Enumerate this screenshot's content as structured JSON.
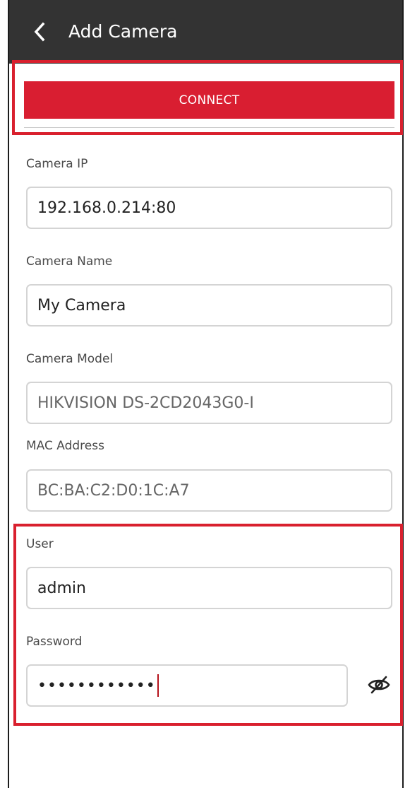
{
  "header": {
    "title": "Add Camera",
    "back_icon": "chevron-left-icon"
  },
  "connect": {
    "label": "CONNECT"
  },
  "fields": {
    "camera_ip": {
      "label": "Camera IP",
      "value": "192.168.0.214:80"
    },
    "camera_name": {
      "label": "Camera Name",
      "value": "My Camera"
    },
    "camera_model": {
      "label": "Camera Model",
      "value": "HIKVISION DS-2CD2043G0-I"
    },
    "mac_address": {
      "label": "MAC Address",
      "value": "BC:BA:C2:D0:1C:A7"
    },
    "user": {
      "label": "User",
      "value": "admin"
    },
    "password": {
      "label": "Password",
      "value": "••••••••••••",
      "toggle_icon": "eye-off-icon"
    }
  },
  "colors": {
    "accent": "#d91e31",
    "appbar": "#333333",
    "highlight": "#d9202e"
  }
}
